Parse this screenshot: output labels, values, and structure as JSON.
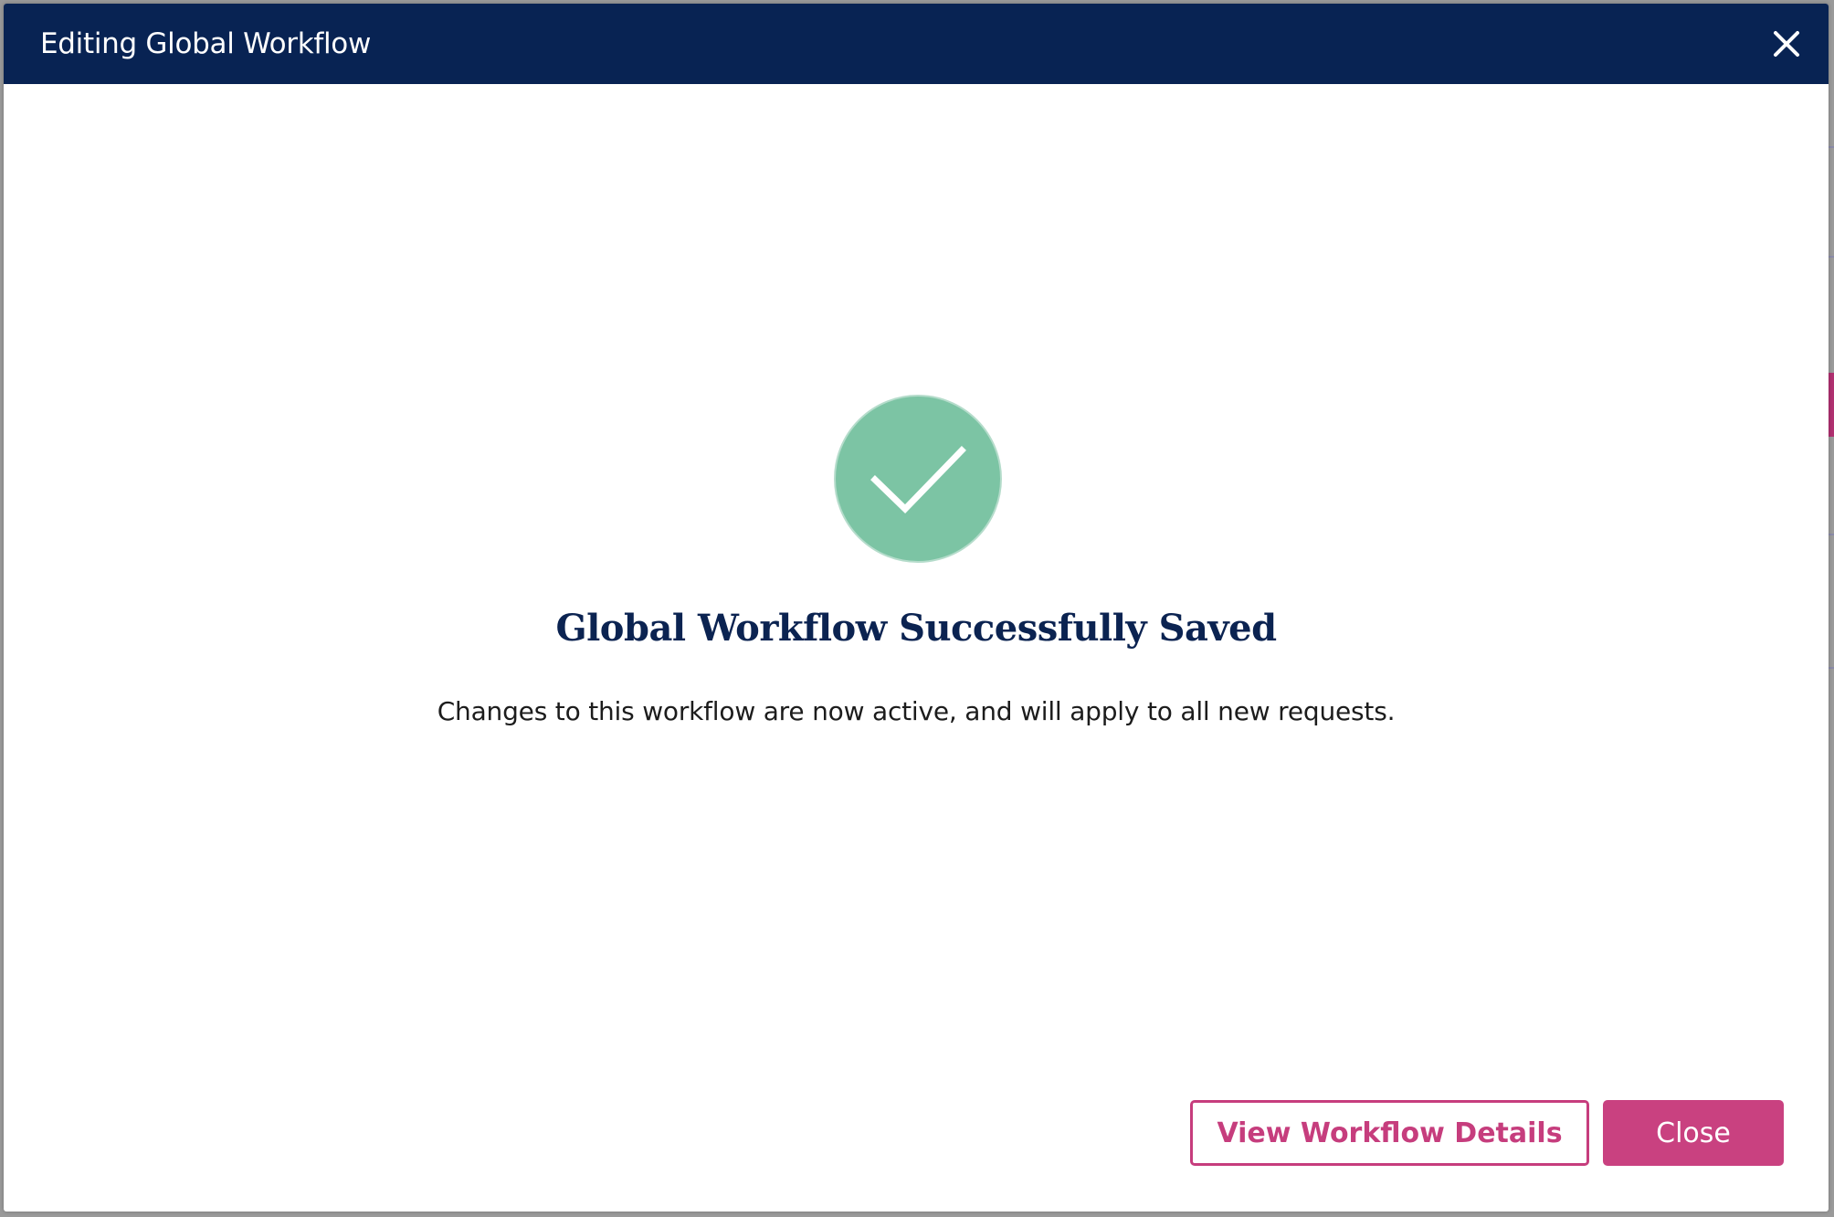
{
  "modal": {
    "title": "Editing Global Workflow",
    "close_icon": "close-icon"
  },
  "success": {
    "icon": "checkmark-icon",
    "icon_color": "#7cc4a4",
    "heading": "Global Workflow Successfully Saved",
    "message": "Changes to this workflow are now active, and will apply to all new requests."
  },
  "actions": {
    "view_details_label": "View Workflow Details",
    "close_label": "Close"
  },
  "colors": {
    "header_bg": "#082353",
    "accent": "#c94180",
    "heading_text": "#0b2351"
  }
}
